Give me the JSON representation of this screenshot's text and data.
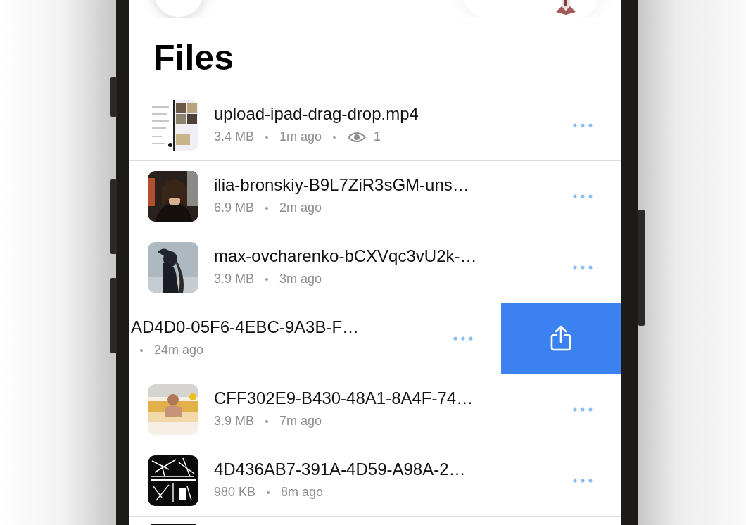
{
  "title": "Files",
  "files": [
    {
      "name": "upload-ipad-drag-drop.mp4",
      "size": "3.4 MB",
      "time": "1m ago",
      "views": "1",
      "swiped": false
    },
    {
      "name": "ilia-bronskiy-B9L7ZiR3sGM-uns…",
      "size": "6.9 MB",
      "time": "2m ago",
      "swiped": false
    },
    {
      "name": "max-ovcharenko-bCXVqc3vU2k-…",
      "size": "3.9 MB",
      "time": "3m ago",
      "swiped": false
    },
    {
      "name": "AD4D0-05F6-4EBC-9A3B-F…",
      "time": "24m ago",
      "swiped": true
    },
    {
      "name": "CFF302E9-B430-48A1-8A4F-74…",
      "size": "3.9 MB",
      "time": "7m ago",
      "swiped": false
    },
    {
      "name": "4D436AB7-391A-4D59-A98A-2…",
      "size": "980 KB",
      "time": "8m ago",
      "swiped": false
    }
  ]
}
